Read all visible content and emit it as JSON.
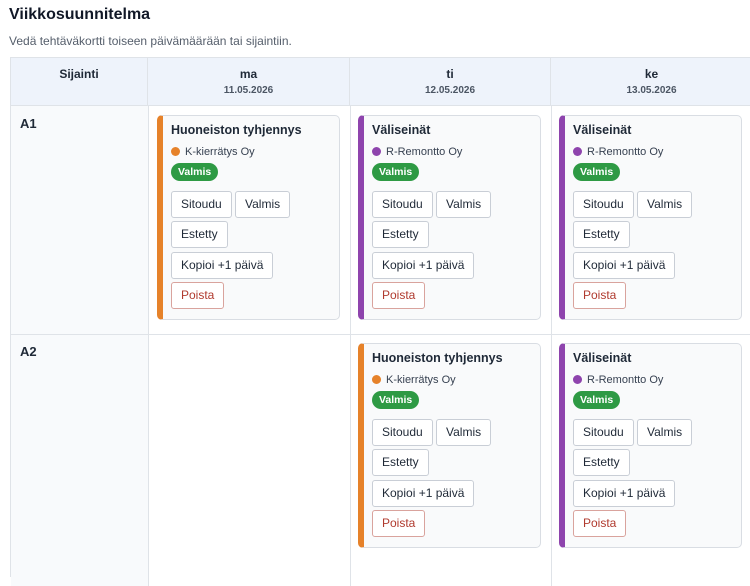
{
  "page": {
    "title": "Viikkosuunnitelma",
    "subtitle": "Vedä tehtäväkortti toiseen päivämäärään tai sijaintiin."
  },
  "grid": {
    "location_header": "Sijainti",
    "days": [
      {
        "name": "ma",
        "date": "11.05.2026"
      },
      {
        "name": "ti",
        "date": "12.05.2026"
      },
      {
        "name": "ke",
        "date": "13.05.2026"
      }
    ],
    "rows": [
      {
        "label": "A1"
      },
      {
        "label": "A2"
      }
    ]
  },
  "colors": {
    "orange": "#e6822a",
    "purple": "#8e44ad",
    "status_green": "#2e9a44"
  },
  "buttons": {
    "commit": "Sitoudu",
    "ready": "Valmis",
    "blocked": "Estetty",
    "copy": "Kopioi +1 päivä",
    "delete": "Poista"
  },
  "cards": [
    {
      "title": "Huoneiston tyhjennys",
      "owner": "K-kierrätys Oy",
      "status": "Valmis",
      "color": "orange"
    },
    {
      "title": "Väliseinät",
      "owner": "R-Remontto Oy",
      "status": "Valmis",
      "color": "purple"
    },
    {
      "title": "Väliseinät",
      "owner": "R-Remontto Oy",
      "status": "Valmis",
      "color": "purple"
    },
    {
      "title": "Huoneiston tyhjennys",
      "owner": "K-kierrätys Oy",
      "status": "Valmis",
      "color": "orange"
    },
    {
      "title": "Väliseinät",
      "owner": "R-Remontto Oy",
      "status": "Valmis",
      "color": "purple"
    }
  ]
}
